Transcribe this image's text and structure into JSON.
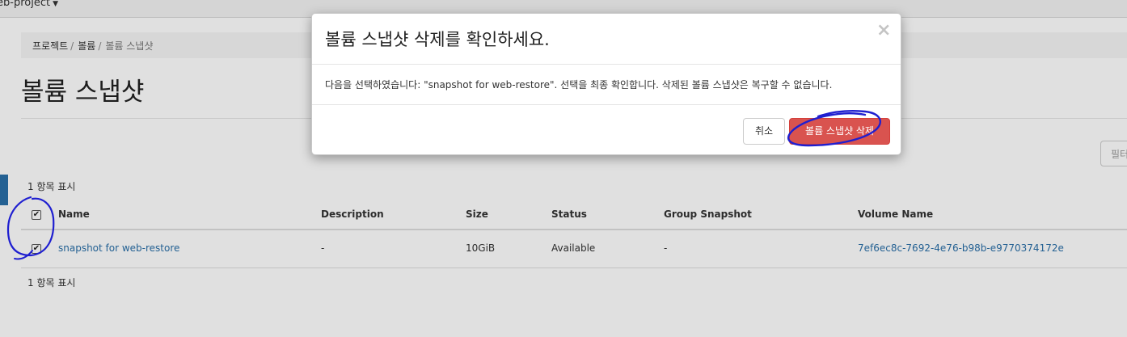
{
  "topbar": {
    "project_name": "eb-project"
  },
  "breadcrumb": {
    "items": [
      "프로젝트",
      "볼륨"
    ],
    "current": "볼륨 스냅샷"
  },
  "page": {
    "title": "볼륨 스냅샷",
    "filter_placeholder": "필터"
  },
  "table": {
    "count_top": "1 항목 표시",
    "count_bottom": "1 항목 표시",
    "headers": [
      "Name",
      "Description",
      "Size",
      "Status",
      "Group Snapshot",
      "Volume Name"
    ],
    "rows": [
      {
        "name": "snapshot for web-restore",
        "description": "-",
        "size": "10GiB",
        "status": "Available",
        "group_snapshot": "-",
        "volume_name": "7ef6ec8c-7692-4e76-b98b-e9770374172e",
        "checked": true
      }
    ],
    "select_all_checked": true
  },
  "modal": {
    "title": "볼륨 스냅샷 삭제를 확인하세요.",
    "close_glyph": "×",
    "body": "다음을 선택하였습니다: \"snapshot for web-restore\". 선택을 최종 확인합니다. 삭제된 볼륨 스냅샷은 복구할 수 없습니다.",
    "cancel_label": "취소",
    "confirm_label": "볼륨 스냅샷 삭제"
  },
  "colors": {
    "danger": "#d9534f",
    "link": "#2a6fa8",
    "annotation": "#1f1fd0"
  },
  "icons": {
    "caret": "caret-down-icon",
    "check": "checkbox-checked-icon",
    "close": "close-icon"
  }
}
